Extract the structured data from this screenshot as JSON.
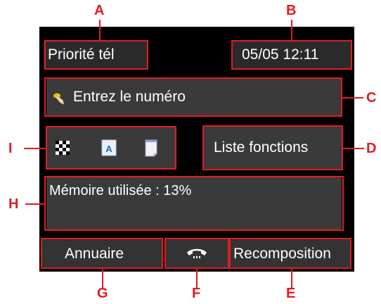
{
  "status": {
    "mode": "Priorité tél",
    "datetime": "05/05 12:11"
  },
  "entry": {
    "placeholder": "Entrez le numéro",
    "icon": "finger-touch-icon"
  },
  "quick_icons": [
    "resolution-icon",
    "contrast-icon",
    "scan-size-icon"
  ],
  "function_list_label": "Liste fonctions",
  "memory_text": "Mémoire utilisée : 13%",
  "bottom": {
    "directory_label": "Annuaire",
    "hook_icon": "phone-handset-icon",
    "redial_label": "Recomposition"
  },
  "callouts": {
    "a": "A",
    "b": "B",
    "c": "C",
    "d": "D",
    "e": "E",
    "f": "F",
    "g": "G",
    "h": "H",
    "i": "I"
  },
  "colors": {
    "callout": "#e31b23",
    "panel": "#2a2a2a",
    "screen": "#000000"
  }
}
